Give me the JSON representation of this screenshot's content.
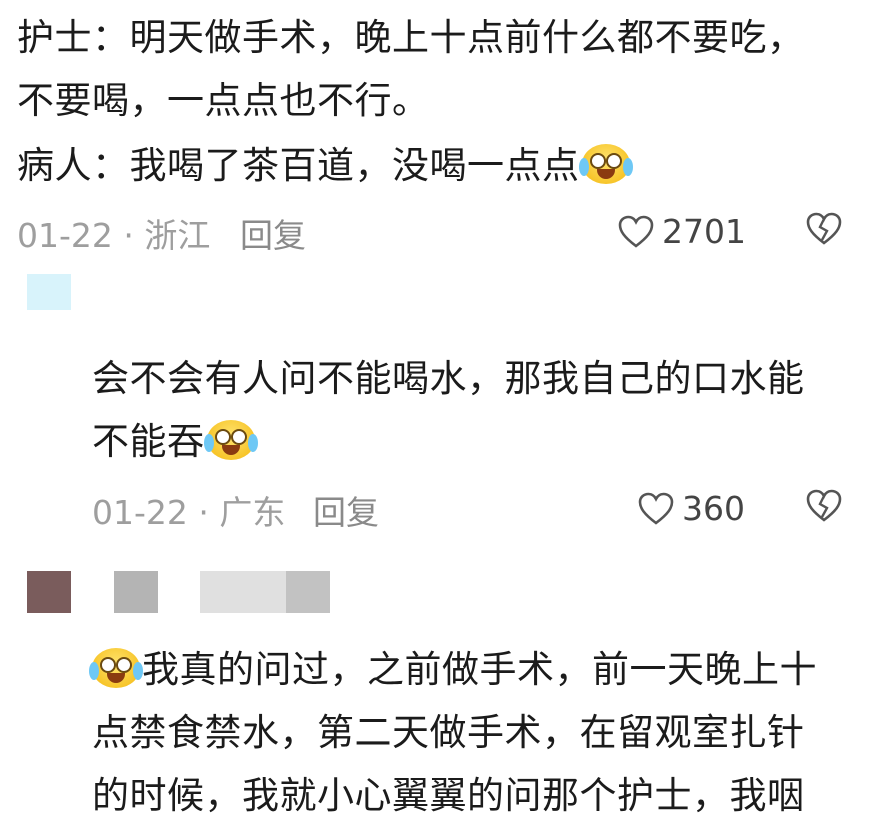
{
  "comment1": {
    "lines": [
      "护士：明天做手术，晚上十点前什么都不要吃，",
      "不要喝，一点点也不行。",
      "病人：我喝了茶百道，没喝一点点"
    ],
    "emoji": "crying-laughing-emoji",
    "meta": "01-22 · 浙江",
    "reply_label": "回复",
    "likes": "2701"
  },
  "comment2": {
    "lines": [
      "会不会有人问不能喝水，那我自己的口水能",
      "不能吞"
    ],
    "emoji": "crying-laughing-emoji",
    "meta": "01-22 · 广东",
    "reply_label": "回复",
    "likes": "360"
  },
  "comment3": {
    "lines": [
      "我真的问过，之前做手术，前一天晚上十",
      "点禁食禁水，第二天做手术，在留观室扎针",
      "的时候，我就小心翼翼的问那个护士，我咽"
    ],
    "emoji": "crying-laughing-emoji"
  },
  "colors": {
    "avatar_blurred_1": "#d8f3fb",
    "avatar_blurred_2": "#7a5c5c",
    "name_blurred_1": "#b4b4b4",
    "name_blurred_2": "#e0e0e0",
    "name_blurred_3": "#c2c2c2"
  }
}
